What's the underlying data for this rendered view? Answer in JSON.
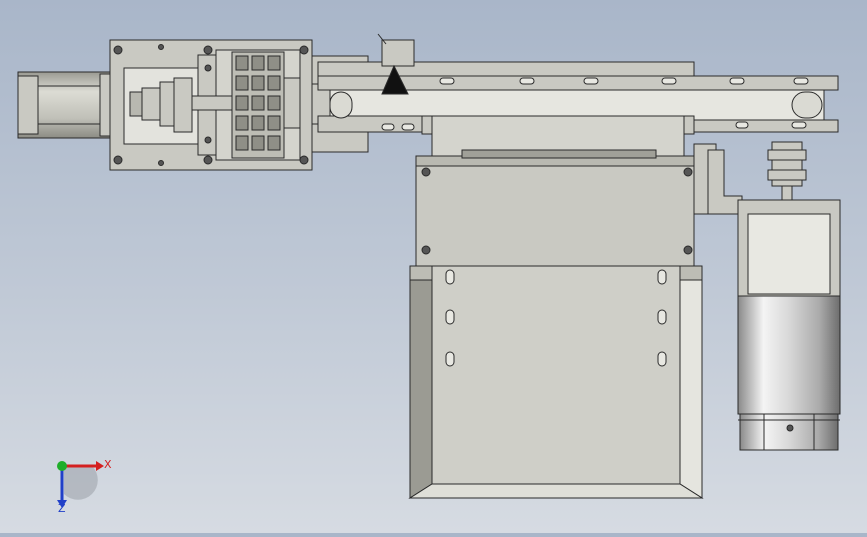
{
  "viewport": {
    "background_top": "#a9b6c9",
    "background_bottom": "#d6dbe2"
  },
  "model": {
    "part_fill": "#c9c9c2",
    "part_stroke": "#2a2a2a",
    "shadow_fill": "#9e9e98",
    "motor_metal_light": "#f2f2f2",
    "motor_metal_dark": "#7a7a7a"
  },
  "triad": {
    "x_label": "X",
    "z_label": "Z",
    "x_color": "#d42020",
    "y_color": "#1fae2a",
    "z_color": "#2140c8"
  }
}
